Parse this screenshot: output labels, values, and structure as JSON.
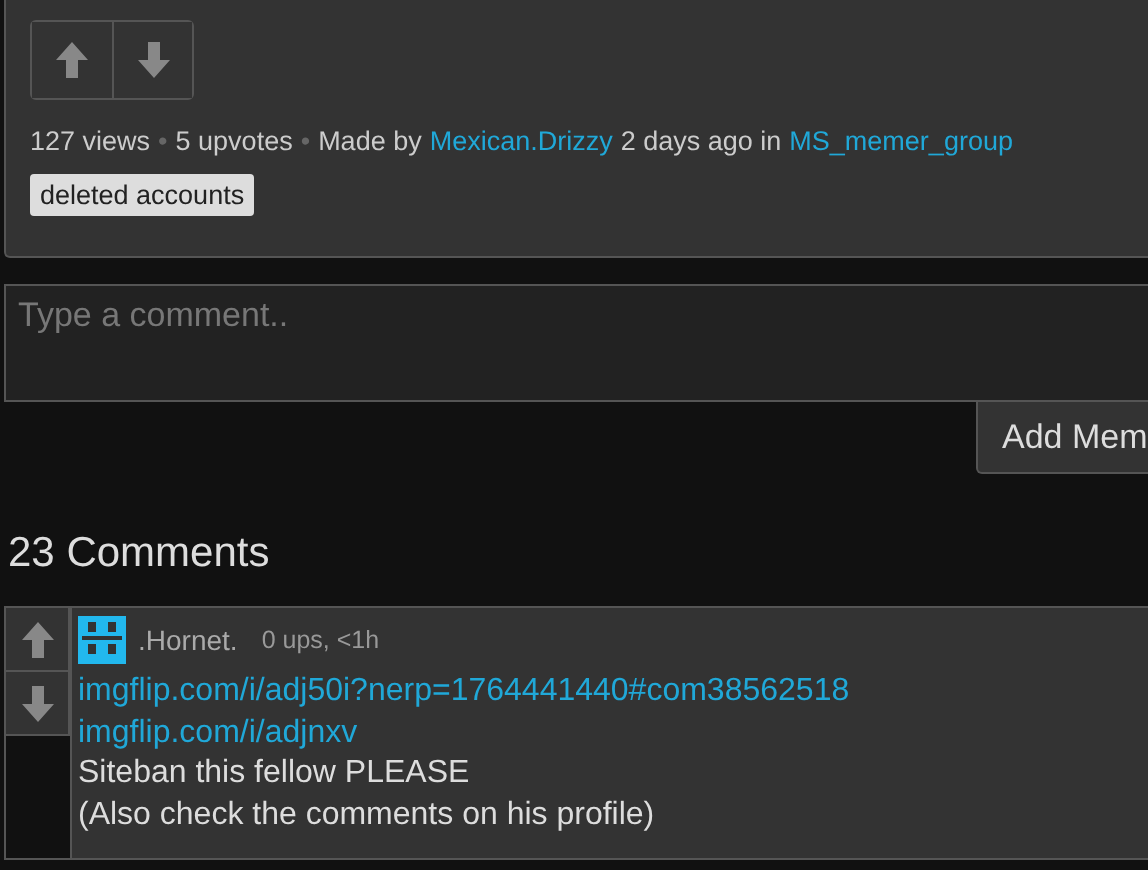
{
  "post": {
    "vote_buttons": [
      {
        "kind": "up",
        "selected": false
      },
      {
        "kind": "down",
        "selected": false
      }
    ],
    "stats": [
      {
        "kind": "text",
        "text": "127 views"
      },
      {
        "kind": "sep",
        "text": "•"
      },
      {
        "kind": "text",
        "text": "5 upvotes"
      },
      {
        "kind": "sep",
        "text": "•"
      },
      {
        "kind": "text",
        "text": "Made by"
      },
      {
        "kind": "link",
        "text": "Mexican.Drizzy"
      },
      {
        "kind": "text",
        "text": "2 days ago in"
      },
      {
        "kind": "link",
        "text": "MS_memer_group"
      }
    ],
    "tags": [
      "deleted accounts"
    ]
  },
  "comment_form": {
    "placeholder": "Type a comment..",
    "submit": "Add Mem"
  },
  "comments_heading": "23 Comments",
  "comments": [
    {
      "username": ".Hornet.",
      "meta": "0 ups, <1h",
      "lines": [
        {
          "kind": "link",
          "text": "imgflip.com/i/adj50i?nerp=1764441440#com38562518"
        },
        {
          "kind": "link",
          "text": "imgflip.com/i/adjnxv"
        },
        {
          "kind": "text",
          "text": "Siteban this fellow PLEASE"
        },
        {
          "kind": "text",
          "text": "(Also check the comments on his profile)"
        }
      ]
    }
  ]
}
